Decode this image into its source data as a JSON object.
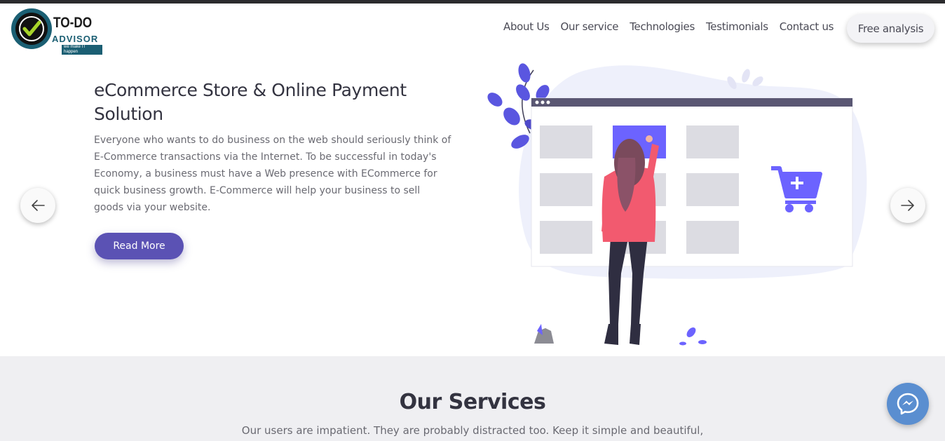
{
  "brand": {
    "title": "TO-DO",
    "subtitle": "ADVISOR",
    "tagline": "we make IT happen"
  },
  "nav": {
    "links": [
      "About Us",
      "Our service",
      "Technologies",
      "Testimonials",
      "Contact us"
    ],
    "cta": "Free analysis"
  },
  "hero": {
    "title": "eCommerce Store & Online Payment Solution",
    "body": "Everyone who wants to do business on the web should seriously think of E-Commerce transactions via the Internet. To be successful in today's Economy, a business must have a Web presence with ECommerce for quick business growth. E-Commerce will help your business to sell goods via your website.",
    "button": "Read More",
    "prev_icon": "arrow-left-icon",
    "next_icon": "arrow-right-icon"
  },
  "services": {
    "title": "Our Services",
    "subtitle": "Our users are impatient. They are probably distracted too. Keep it simple and beautiful,"
  },
  "colors": {
    "accent": "#5b52b4",
    "illustration_purple": "#6c63ff",
    "services_bg": "#efeff2",
    "messenger": "#5a8ed0"
  },
  "icons": {
    "chat": "messenger-icon",
    "cart": "shopping-cart-icon"
  }
}
